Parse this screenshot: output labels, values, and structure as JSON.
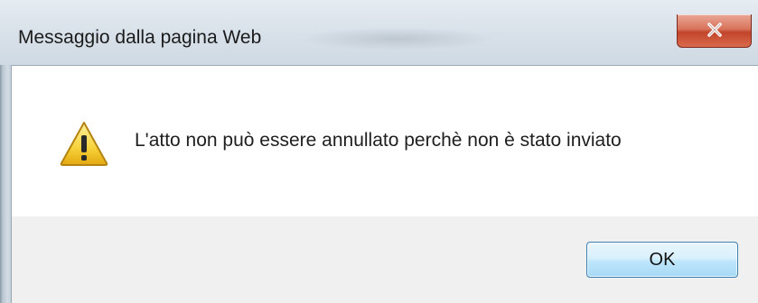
{
  "window": {
    "title": "Messaggio dalla pagina Web",
    "close_icon": "close-x-icon"
  },
  "dialog": {
    "icon": "warning-icon",
    "message": "L'atto non può essere annullato perchè non è stato inviato"
  },
  "buttons": {
    "ok_label": "OK"
  }
}
